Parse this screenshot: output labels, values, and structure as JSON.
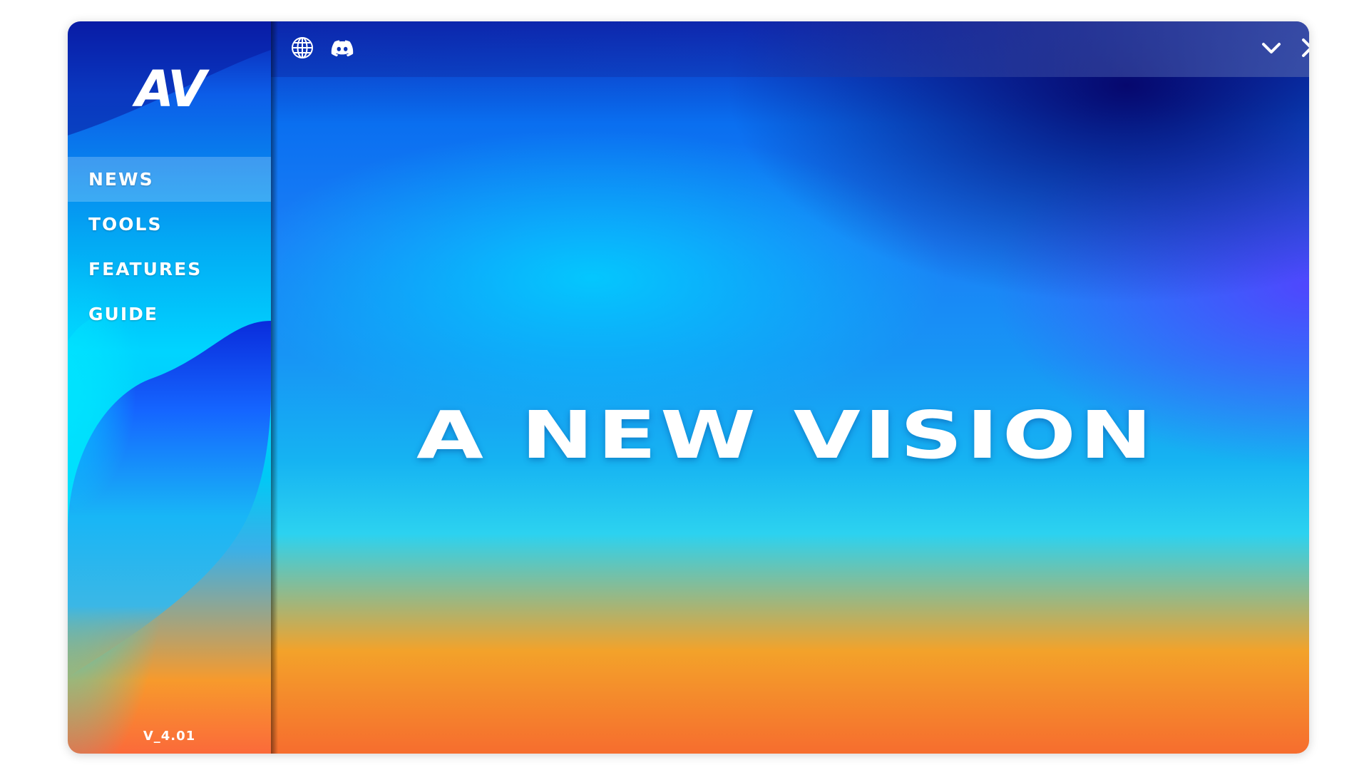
{
  "app": {
    "logo_text": "AV",
    "version": "V_4.01"
  },
  "sidebar": {
    "items": [
      {
        "label": "NEWS",
        "active": true
      },
      {
        "label": "TOOLS",
        "active": false
      },
      {
        "label": "FEATURES",
        "active": false
      },
      {
        "label": "GUIDE",
        "active": false
      }
    ]
  },
  "topbar": {
    "left_icons": [
      "globe-icon",
      "discord-icon"
    ],
    "right_icons": [
      "chevron-down-icon",
      "close-icon"
    ]
  },
  "main": {
    "headline": "A NEW VISION"
  },
  "colors": {
    "sidebar_top": "#0a1fae",
    "sidebar_mid": "#00d4ff",
    "sidebar_bottom": "#fb6a3a",
    "main_deep_blue": "#06086e",
    "main_cyan": "#2cd2f0",
    "main_orange": "#f66d2e",
    "text": "#ffffff"
  }
}
